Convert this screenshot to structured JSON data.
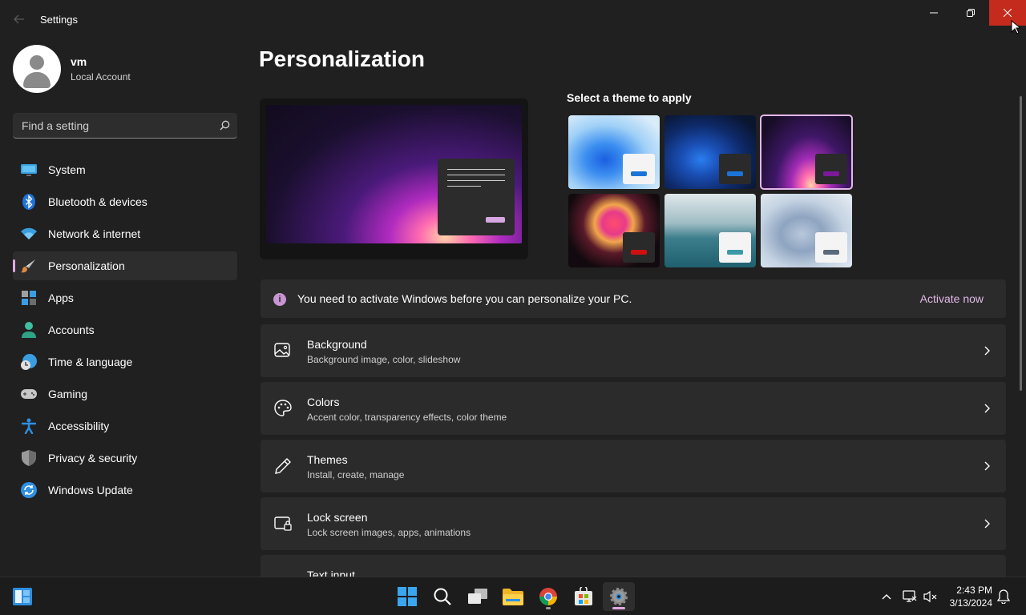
{
  "window": {
    "title": "Settings",
    "controls": [
      "minimize",
      "restore",
      "close"
    ]
  },
  "profile": {
    "name": "vm",
    "account_type": "Local Account"
  },
  "search": {
    "placeholder": "Find a setting"
  },
  "sidebar": {
    "items": [
      {
        "label": "System",
        "icon": "system-icon"
      },
      {
        "label": "Bluetooth & devices",
        "icon": "bluetooth-icon"
      },
      {
        "label": "Network & internet",
        "icon": "wifi-icon"
      },
      {
        "label": "Personalization",
        "icon": "brush-icon",
        "active": true
      },
      {
        "label": "Apps",
        "icon": "apps-icon"
      },
      {
        "label": "Accounts",
        "icon": "accounts-icon"
      },
      {
        "label": "Time & language",
        "icon": "globe-clock-icon"
      },
      {
        "label": "Gaming",
        "icon": "gamepad-icon"
      },
      {
        "label": "Accessibility",
        "icon": "accessibility-icon"
      },
      {
        "label": "Privacy & security",
        "icon": "shield-icon"
      },
      {
        "label": "Windows Update",
        "icon": "update-icon"
      }
    ]
  },
  "main": {
    "title": "Personalization",
    "theme_section_label": "Select a theme to apply",
    "themes": [
      {
        "name": "windows-light",
        "selected": false
      },
      {
        "name": "windows-dark",
        "selected": false
      },
      {
        "name": "glow",
        "selected": true
      },
      {
        "name": "captured-motion",
        "selected": false
      },
      {
        "name": "sunrise",
        "selected": false
      },
      {
        "name": "flow",
        "selected": false
      }
    ],
    "activation_notice": {
      "text": "You need to activate Windows before you can personalize your PC.",
      "link": "Activate now"
    },
    "cards": [
      {
        "title": "Background",
        "subtitle": "Background image, color, slideshow",
        "icon": "image-icon"
      },
      {
        "title": "Colors",
        "subtitle": "Accent color, transparency effects, color theme",
        "icon": "palette-icon"
      },
      {
        "title": "Themes",
        "subtitle": "Install, create, manage",
        "icon": "pen-icon"
      },
      {
        "title": "Lock screen",
        "subtitle": "Lock screen images, apps, animations",
        "icon": "lock-screen-icon"
      },
      {
        "title": "Text input",
        "subtitle": "",
        "icon": "keyboard-icon"
      }
    ]
  },
  "taskbar": {
    "apps": [
      "start",
      "search",
      "task-view",
      "file-explorer",
      "chrome",
      "microsoft-store",
      "settings"
    ],
    "active_app": "settings",
    "time": "2:43 PM",
    "date": "3/13/2024"
  },
  "colors": {
    "accent": "#e3a7e3",
    "close_button": "#c42b1c",
    "background": "#202020",
    "card": "#2b2b2b"
  }
}
